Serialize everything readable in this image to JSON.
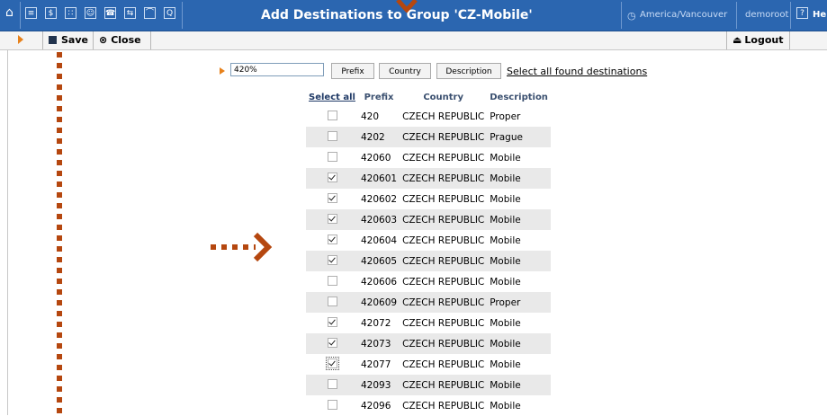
{
  "header": {
    "title": "Add Destinations to Group 'CZ-Mobile'",
    "timezone": "America/Vancouver",
    "user": "demoroot",
    "help_label": "He",
    "icons": [
      "home-icon",
      "list-icon",
      "dollar-icon",
      "grid-icon",
      "person-icon",
      "phone-icon",
      "transfer-icon",
      "chart-icon",
      "search-icon",
      "clock-icon",
      "help-icon"
    ]
  },
  "toolbar": {
    "save_label": "Save",
    "close_label": "Close",
    "logout_label": "Logout"
  },
  "search": {
    "value": "420%",
    "buttons": [
      "Prefix",
      "Country",
      "Description"
    ],
    "select_all_found": "Select all found destinations"
  },
  "table": {
    "headers": [
      "Select all",
      "Prefix",
      "Country",
      "Description"
    ],
    "rows": [
      {
        "checked": false,
        "prefix": "420",
        "country": "CZECH REPUBLIC",
        "description": "Proper"
      },
      {
        "checked": false,
        "prefix": "4202",
        "country": "CZECH REPUBLIC",
        "description": "Prague"
      },
      {
        "checked": false,
        "prefix": "42060",
        "country": "CZECH REPUBLIC",
        "description": "Mobile"
      },
      {
        "checked": true,
        "prefix": "420601",
        "country": "CZECH REPUBLIC",
        "description": "Mobile"
      },
      {
        "checked": true,
        "prefix": "420602",
        "country": "CZECH REPUBLIC",
        "description": "Mobile"
      },
      {
        "checked": true,
        "prefix": "420603",
        "country": "CZECH REPUBLIC",
        "description": "Mobile"
      },
      {
        "checked": true,
        "prefix": "420604",
        "country": "CZECH REPUBLIC",
        "description": "Mobile"
      },
      {
        "checked": true,
        "prefix": "420605",
        "country": "CZECH REPUBLIC",
        "description": "Mobile"
      },
      {
        "checked": false,
        "prefix": "420606",
        "country": "CZECH REPUBLIC",
        "description": "Mobile"
      },
      {
        "checked": false,
        "prefix": "420609",
        "country": "CZECH REPUBLIC",
        "description": "Proper"
      },
      {
        "checked": true,
        "prefix": "42072",
        "country": "CZECH REPUBLIC",
        "description": "Mobile"
      },
      {
        "checked": true,
        "prefix": "42073",
        "country": "CZECH REPUBLIC",
        "description": "Mobile"
      },
      {
        "checked": true,
        "prefix": "42077",
        "country": "CZECH REPUBLIC",
        "description": "Mobile",
        "focused": true
      },
      {
        "checked": false,
        "prefix": "42093",
        "country": "CZECH REPUBLIC",
        "description": "Mobile"
      },
      {
        "checked": false,
        "prefix": "42096",
        "country": "CZECH REPUBLIC",
        "description": "Mobile"
      }
    ]
  },
  "colors": {
    "header_bg": "#2b66b0",
    "accent_orange": "#e7811a",
    "annotation_brown": "#b5470f",
    "row_alt": "#e9e9e9"
  }
}
